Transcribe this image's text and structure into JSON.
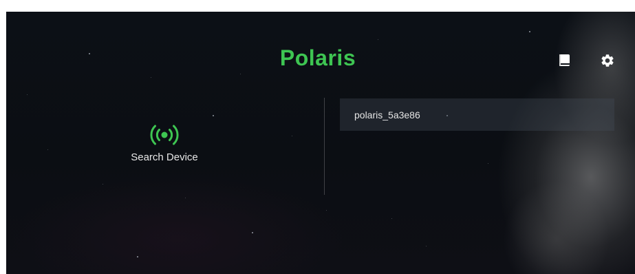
{
  "app": {
    "title": "Polaris",
    "accent_color": "#3ec552"
  },
  "header": {
    "book_icon": "book-icon",
    "settings_icon": "gear-icon"
  },
  "search": {
    "icon": "radar-broadcast-icon",
    "label": "Search Device"
  },
  "devices": [
    {
      "name": "polaris_5a3e86"
    }
  ]
}
